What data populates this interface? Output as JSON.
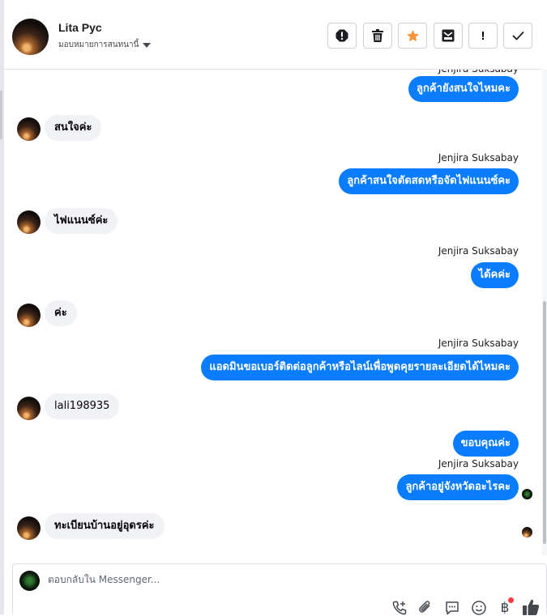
{
  "header": {
    "contact_name": "Lita Pyc",
    "assign_label": "มอบหมายการสนทนานี้"
  },
  "toolbar": {
    "icons": [
      "spam-icon",
      "trash-icon",
      "star-icon",
      "archive-icon",
      "exclamation-icon",
      "check-icon"
    ],
    "exclamation_text": "!",
    "accent_color": "#f5933a"
  },
  "messages": {
    "m1_text": "ลูกค้ายังสนใจไหมคะ",
    "m2_text": "สนใจค่ะ",
    "m3_sender": "Jenjira Suksabay",
    "m3_text": "ลูกค้าสนใจตัดสดหรือจัดไฟแนนซ์คะ",
    "m4_text": "ไฟแนนซ์ค่ะ",
    "m5_sender": "Jenjira Suksabay",
    "m5_text": "ได้คค่ะ",
    "m6_text": "ค่ะ",
    "m7_sender": "Jenjira Suksabay",
    "m7_text": "แอดมินขอเบอร์ติดต่อลูกค้าหรือไลน์เพื่อพูดคุยรายละเอียดได้ไหมคะ",
    "m8_text": "lali198935",
    "m9_text": "ขอบคุณค่ะ",
    "m10_sender": "Jenjira Suksabay",
    "m10_text": "ลูกค้าอยู่จังหวัดอะไรคะ",
    "m11_text": "ทะเบียนบ้านอยู่อุดรค่ะ"
  },
  "composer": {
    "placeholder": "ตอบกลับใน Messenger...",
    "icons": [
      "call-add-icon",
      "attachment-icon",
      "saved-reply-icon",
      "emoji-icon",
      "baht-payment-icon",
      "thumbs-up-icon"
    ],
    "baht_symbol": "฿"
  },
  "colors": {
    "outgoing_bubble": "#0a7cff",
    "incoming_bubble": "#f0f2f5",
    "notification_dot": "#fa383e"
  }
}
